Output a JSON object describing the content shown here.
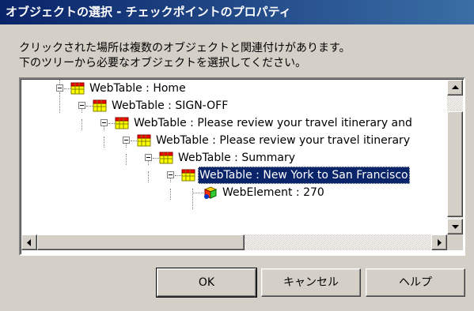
{
  "window": {
    "title": "オブジェクトの選択 - チェックポイントのプロパティ"
  },
  "instructions": {
    "line1": "クリックされた場所は複数のオブジェクトと関連付けがあります。",
    "line2": "下のツリーから必要なオブジェクトを選択してください。"
  },
  "tree": {
    "nodes": [
      {
        "label": "WebTable : Home",
        "icon": "webtable-icon",
        "expanded": true
      },
      {
        "label": "WebTable : SIGN-OFF",
        "icon": "webtable-icon",
        "expanded": true
      },
      {
        "label": "WebTable : Please review your travel itinerary and",
        "icon": "webtable-icon",
        "expanded": true
      },
      {
        "label": "WebTable : Please review your travel itinerary",
        "icon": "webtable-icon",
        "expanded": true
      },
      {
        "label": "WebTable : Summary",
        "icon": "webtable-icon",
        "expanded": true
      },
      {
        "label": "WebTable : New York to San Francisco",
        "icon": "webtable-icon",
        "expanded": true,
        "selected": true
      },
      {
        "label": "WebElement : 270",
        "icon": "webelement-icon",
        "expanded": false
      }
    ]
  },
  "buttons": {
    "ok": "OK",
    "cancel": "キャンセル",
    "help": "ヘルプ"
  },
  "colors": {
    "title_bar": "#0a246a",
    "selection": "#0a246a",
    "dialog_bg": "#d4d0c8"
  }
}
